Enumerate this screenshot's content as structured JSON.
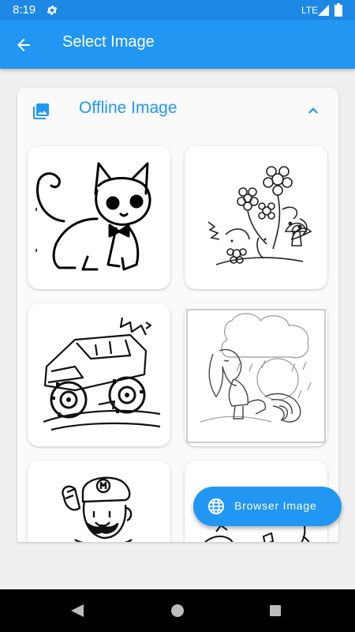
{
  "status_bar": {
    "time": "8:19",
    "network": "LTE",
    "icons": [
      "settings-gear-icon",
      "signal-icon",
      "battery-icon"
    ]
  },
  "app_bar": {
    "title": "Select Image",
    "back_icon": "arrow-back-icon"
  },
  "section": {
    "title": "Offline Image",
    "icon": "photo-library-icon",
    "expanded": true
  },
  "images": [
    {
      "subject": "cat-coloring-page"
    },
    {
      "subject": "flowers-coloring-page"
    },
    {
      "subject": "monster-truck-coloring-page"
    },
    {
      "subject": "pony-in-rain-coloring-page"
    },
    {
      "subject": "plumber-character-coloring-page"
    },
    {
      "subject": "doodle-coloring-page"
    }
  ],
  "fab": {
    "label": "Browser Image",
    "icon": "globe-icon"
  },
  "colors": {
    "primary": "#2196f3",
    "status_bar": "#1e88e5",
    "background": "#efefef"
  }
}
